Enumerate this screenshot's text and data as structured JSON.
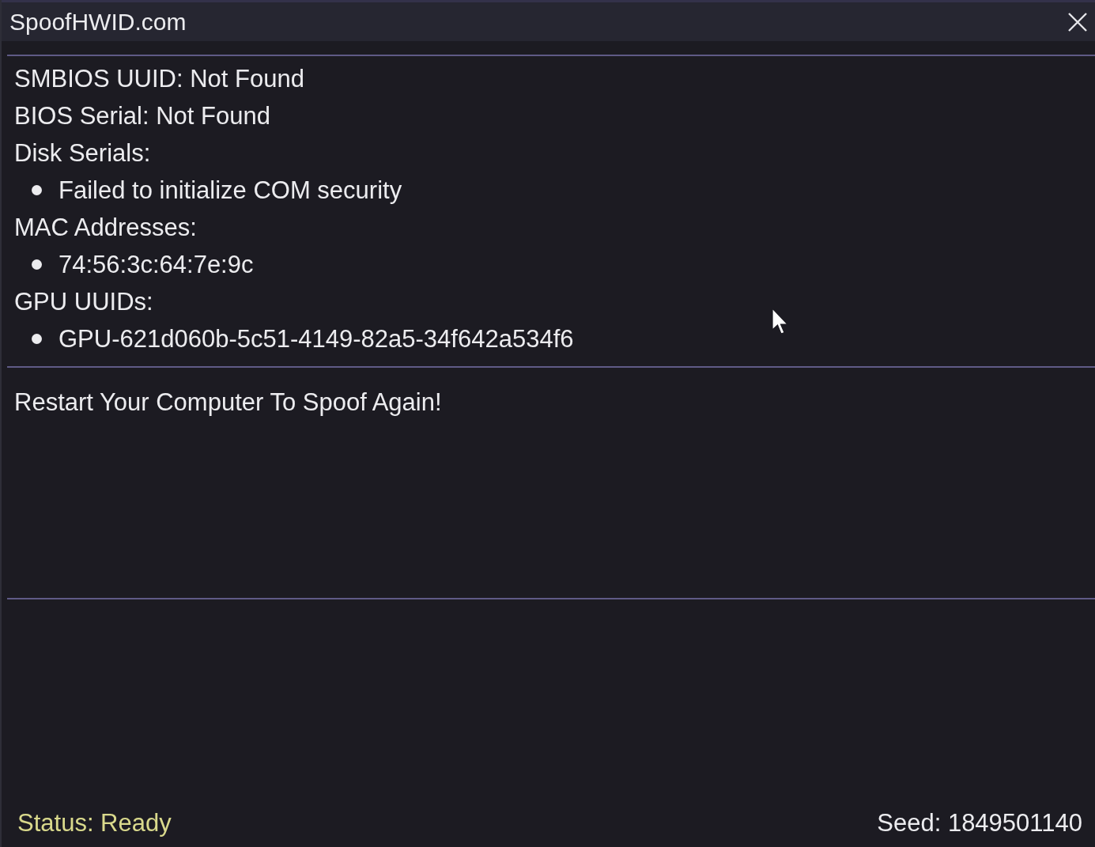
{
  "window": {
    "title": "SpoofHWID.com"
  },
  "info_lines": [
    {
      "kind": "line",
      "text": "SMBIOS UUID: Not Found"
    },
    {
      "kind": "line",
      "text": "BIOS Serial: Not Found"
    },
    {
      "kind": "line",
      "text": "Disk Serials:"
    },
    {
      "kind": "bullet",
      "text": "Failed to initialize COM security"
    },
    {
      "kind": "line",
      "text": "MAC Addresses:"
    },
    {
      "kind": "bullet",
      "text": "74:56:3c:64:7e:9c"
    },
    {
      "kind": "line",
      "text": "GPU UUIDs:"
    },
    {
      "kind": "bullet",
      "text": "GPU-621d060b-5c51-4149-82a5-34f642a534f6"
    }
  ],
  "message": "Restart Your Computer To Spoof Again!",
  "status_bar": {
    "status": "Status: Ready",
    "seed": "Seed: 1849501140"
  }
}
